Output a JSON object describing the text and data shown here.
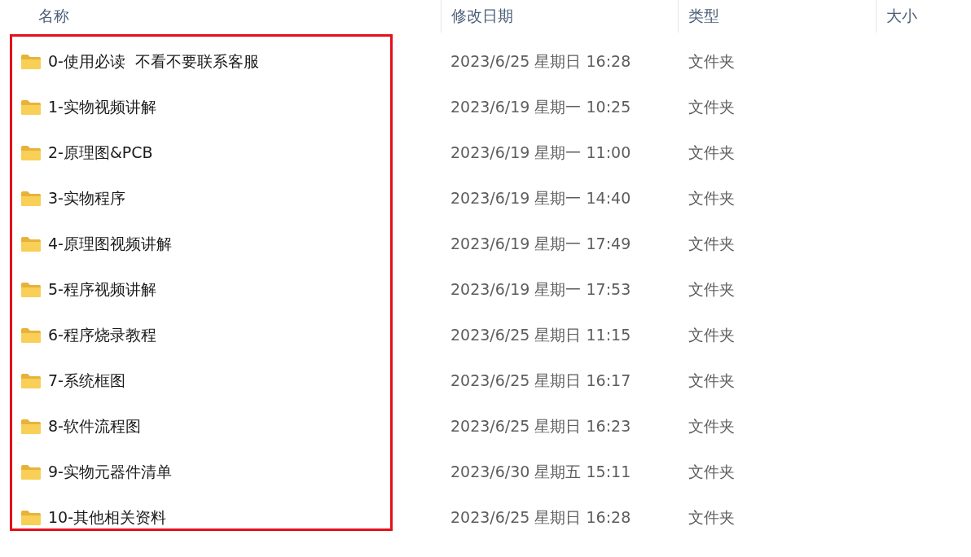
{
  "columns": [
    "名称",
    "修改日期",
    "类型",
    "大小"
  ],
  "rows": [
    {
      "name": "0-使用必读  不看不要联系客服",
      "modified": "2023/6/25 星期日 16:28",
      "type": "文件夹"
    },
    {
      "name": "1-实物视频讲解",
      "modified": "2023/6/19 星期一 10:25",
      "type": "文件夹"
    },
    {
      "name": "2-原理图&PCB",
      "modified": "2023/6/19 星期一 11:00",
      "type": "文件夹"
    },
    {
      "name": "3-实物程序",
      "modified": "2023/6/19 星期一 14:40",
      "type": "文件夹"
    },
    {
      "name": "4-原理图视频讲解",
      "modified": "2023/6/19 星期一 17:49",
      "type": "文件夹"
    },
    {
      "name": "5-程序视频讲解",
      "modified": "2023/6/19 星期一 17:53",
      "type": "文件夹"
    },
    {
      "name": "6-程序烧录教程",
      "modified": "2023/6/25 星期日 11:15",
      "type": "文件夹"
    },
    {
      "name": "7-系统框图",
      "modified": "2023/6/25 星期日 16:17",
      "type": "文件夹"
    },
    {
      "name": "8-软件流程图",
      "modified": "2023/6/25 星期日 16:23",
      "type": "文件夹"
    },
    {
      "name": "9-实物元器件清单",
      "modified": "2023/6/30 星期五 15:11",
      "type": "文件夹"
    },
    {
      "name": "10-其他相关资料",
      "modified": "2023/6/25 星期日 16:28",
      "type": "文件夹"
    }
  ]
}
